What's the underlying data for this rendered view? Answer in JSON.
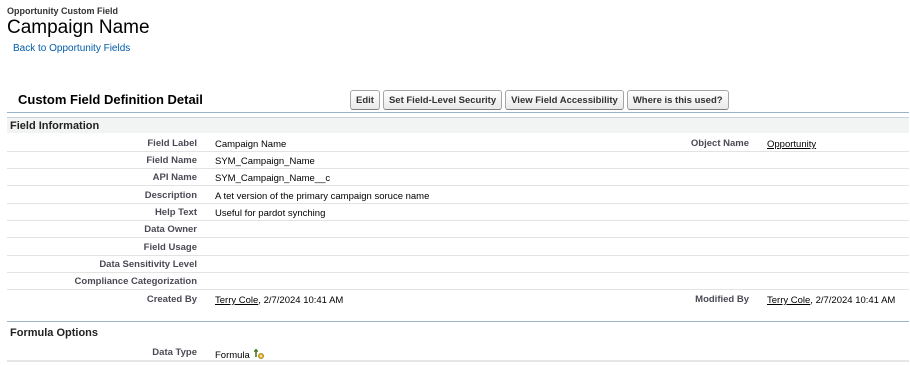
{
  "header": {
    "object_type": "Opportunity Custom Field",
    "title": "Campaign Name",
    "back_link": "Back to Opportunity Fields"
  },
  "detail": {
    "title": "Custom Field Definition Detail",
    "buttons": {
      "edit": "Edit",
      "field_level_security": "Set Field-Level Security",
      "field_accessibility": "View Field Accessibility",
      "where_used": "Where is this used?"
    }
  },
  "field_info": {
    "section_title": "Field Information",
    "field_label": {
      "label": "Field Label",
      "value": "Campaign Name"
    },
    "object_name": {
      "label": "Object Name",
      "value": "Opportunity"
    },
    "field_name": {
      "label": "Field Name",
      "value": "SYM_Campaign_Name"
    },
    "api_name": {
      "label": "API Name",
      "value": "SYM_Campaign_Name__c"
    },
    "description": {
      "label": "Description",
      "value": "A tet version of the primary campaign soruce name"
    },
    "help_text": {
      "label": "Help Text",
      "value": "Useful for pardot synching"
    },
    "data_owner": {
      "label": "Data Owner",
      "value": ""
    },
    "field_usage": {
      "label": "Field Usage",
      "value": ""
    },
    "data_sensitivity": {
      "label": "Data Sensitivity Level",
      "value": ""
    },
    "compliance": {
      "label": "Compliance Categorization",
      "value": ""
    },
    "created_by": {
      "label": "Created By",
      "user": "Terry Cole",
      "date": ", 2/7/2024 10:41 AM"
    },
    "modified_by": {
      "label": "Modified By",
      "user": "Terry Cole",
      "date": ", 2/7/2024 10:41 AM"
    }
  },
  "formula_options": {
    "section_title": "Formula Options",
    "data_type": {
      "label": "Data Type",
      "value": "Formula"
    }
  },
  "icons": {
    "formula": "formula-icon"
  },
  "colors": {
    "link": "#015ba7",
    "section_bg": "#f2f3f3",
    "divider": "#9bb3c8"
  }
}
